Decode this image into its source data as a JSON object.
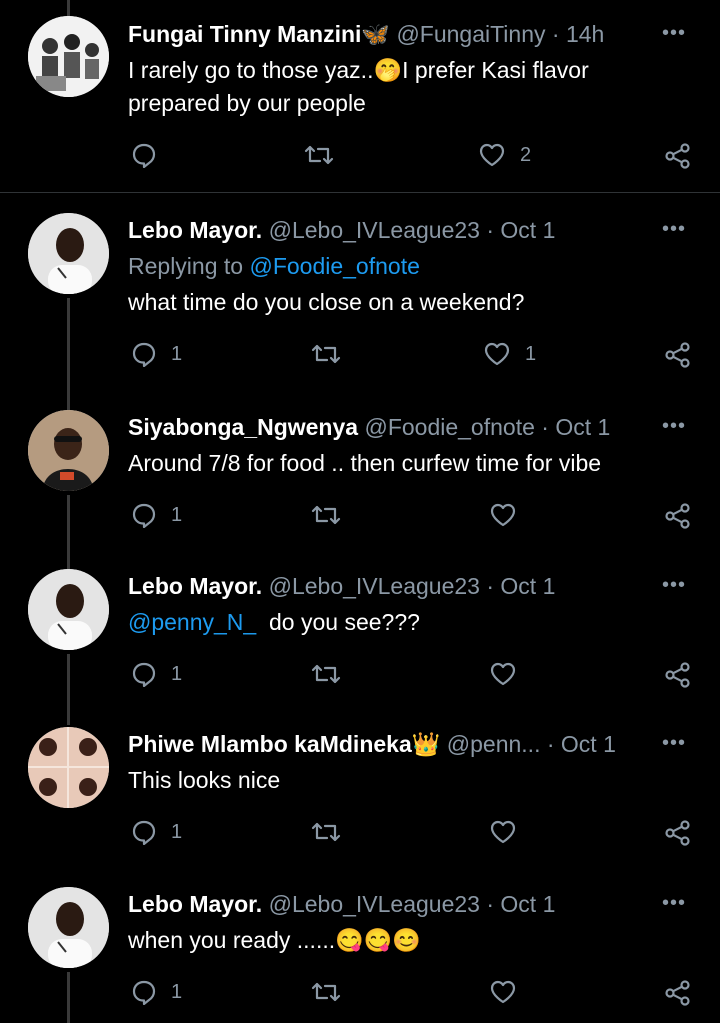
{
  "tweets": [
    {
      "name": "Fungai Tinny Manzini",
      "name_emoji": "🦋",
      "handle": "@FungaiTinny",
      "time": "14h",
      "text_line1": "I rarely go to those yaz..",
      "text_emoji": "🤭",
      "text_line1b": "I prefer Kasi flavor",
      "text_line2": "prepared by our people",
      "likes": "2"
    },
    {
      "name": "Lebo Mayor.",
      "handle": "@Lebo_IVLeague23",
      "time": "Oct 1",
      "reply_prefix": "Replying to",
      "reply_handle": "@Foodie_ofnote",
      "text": "what time do you close on a weekend?",
      "replies": "1",
      "likes": "1"
    },
    {
      "name": "Siyabonga_Ngwenya",
      "handle": "@Foodie_ofnote",
      "time": "Oct 1",
      "text": "Around 7/8 for food .. then curfew time for vibe",
      "replies": "1"
    },
    {
      "name": "Lebo Mayor.",
      "handle": "@Lebo_IVLeague23",
      "time": "Oct 1",
      "mention": "@penny_N_",
      "text": "do you see???",
      "replies": "1"
    },
    {
      "name": "Phiwe Mlambo kaMdineka",
      "name_emoji": "👑",
      "handle": "@penn...",
      "time": "Oct 1",
      "text": "This looks nice",
      "replies": "1"
    },
    {
      "name": "Lebo Mayor.",
      "handle": "@Lebo_IVLeague23",
      "time": "Oct 1",
      "text": "when you ready ......",
      "text_emojis": "😋😋😊",
      "replies": "1"
    }
  ],
  "separator": "·",
  "more_label": "•••",
  "colors": {
    "background": "#000000",
    "secondary": "#8b98a5",
    "link": "#1d9bf0"
  }
}
